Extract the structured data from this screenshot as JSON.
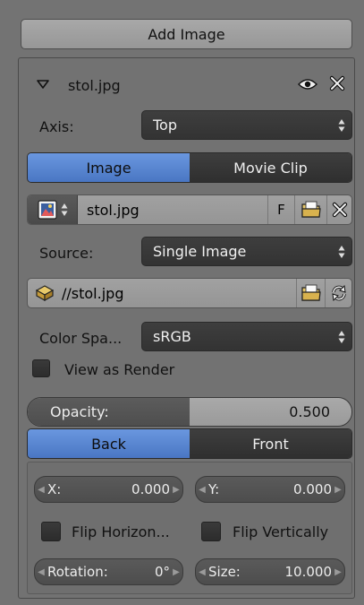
{
  "header": {
    "add_image_label": "Add Image"
  },
  "image_panel": {
    "filename": "stol.jpg",
    "axis_label": "Axis:",
    "axis_value": "Top",
    "source_tabs": [
      {
        "label": "Image",
        "active": true
      },
      {
        "label": "Movie Clip",
        "active": false
      }
    ],
    "datablock_name": "stol.jpg",
    "fake_user_label": "F",
    "source_label": "Source:",
    "source_value": "Single Image",
    "filepath": "//stol.jpg",
    "color_space_label": "Color Spa...",
    "color_space_value": "sRGB",
    "view_as_render_label": "View as Render",
    "view_as_render_checked": false,
    "opacity_label": "Opacity:",
    "opacity_value": "0.500",
    "opacity_fraction": 0.5,
    "draw_tabs": [
      {
        "label": "Back",
        "active": true
      },
      {
        "label": "Front",
        "active": false
      }
    ],
    "offset_x_label": "X:",
    "offset_x_value": "0.000",
    "offset_y_label": "Y:",
    "offset_y_value": "0.000",
    "flip_horizontal_label": "Flip Horizon...",
    "flip_horizontal_checked": false,
    "flip_vertical_label": "Flip Vertically",
    "flip_vertical_checked": false,
    "rotation_label": "Rotation:",
    "rotation_value": "0°",
    "size_label": "Size:",
    "size_value": "10.000"
  },
  "colors": {
    "accent_blue": "#5a87d4",
    "background": "#737373",
    "dark_widget": "#3a3a3a"
  },
  "icons": [
    "triangle-down-icon",
    "eye-icon",
    "close-icon",
    "image-icon",
    "folder-icon",
    "reload-icon",
    "package-icon"
  ]
}
